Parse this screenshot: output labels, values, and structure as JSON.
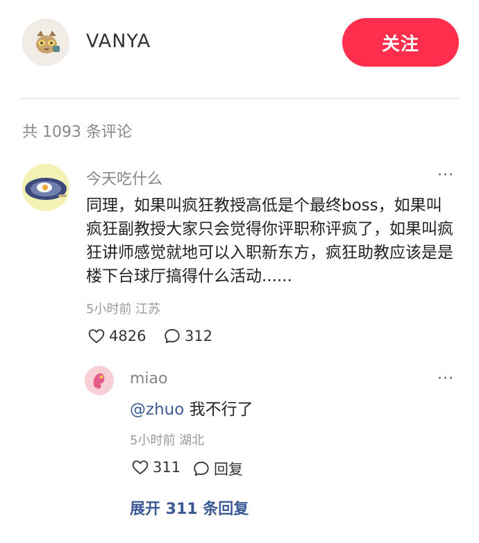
{
  "header": {
    "author_name": "VANYA",
    "follow_label": "关注"
  },
  "comments_total_text": "共 1093 条评论",
  "comment": {
    "username": "今天吃什么",
    "more": "···",
    "text": "同理，如果叫疯狂教授高低是个最终boss，如果叫疯狂副教授大家只会觉得你评职称评疯了，如果叫疯狂讲师感觉就地可以入职新东方，疯狂助教应该是是楼下台球厅搞得什么活动......",
    "meta": "5小时前 江苏",
    "likes": "4826",
    "replies": "312"
  },
  "reply": {
    "username": "miao",
    "more": "···",
    "mention": "@zhuo",
    "text": " 我不行了",
    "meta": "5小时前 湖北",
    "likes": "311",
    "reply_label": "回复"
  },
  "expand_label": "展开 311 条回复",
  "colors": {
    "accent": "#ff2e4d",
    "link": "#3b5a95",
    "muted": "#999999"
  }
}
